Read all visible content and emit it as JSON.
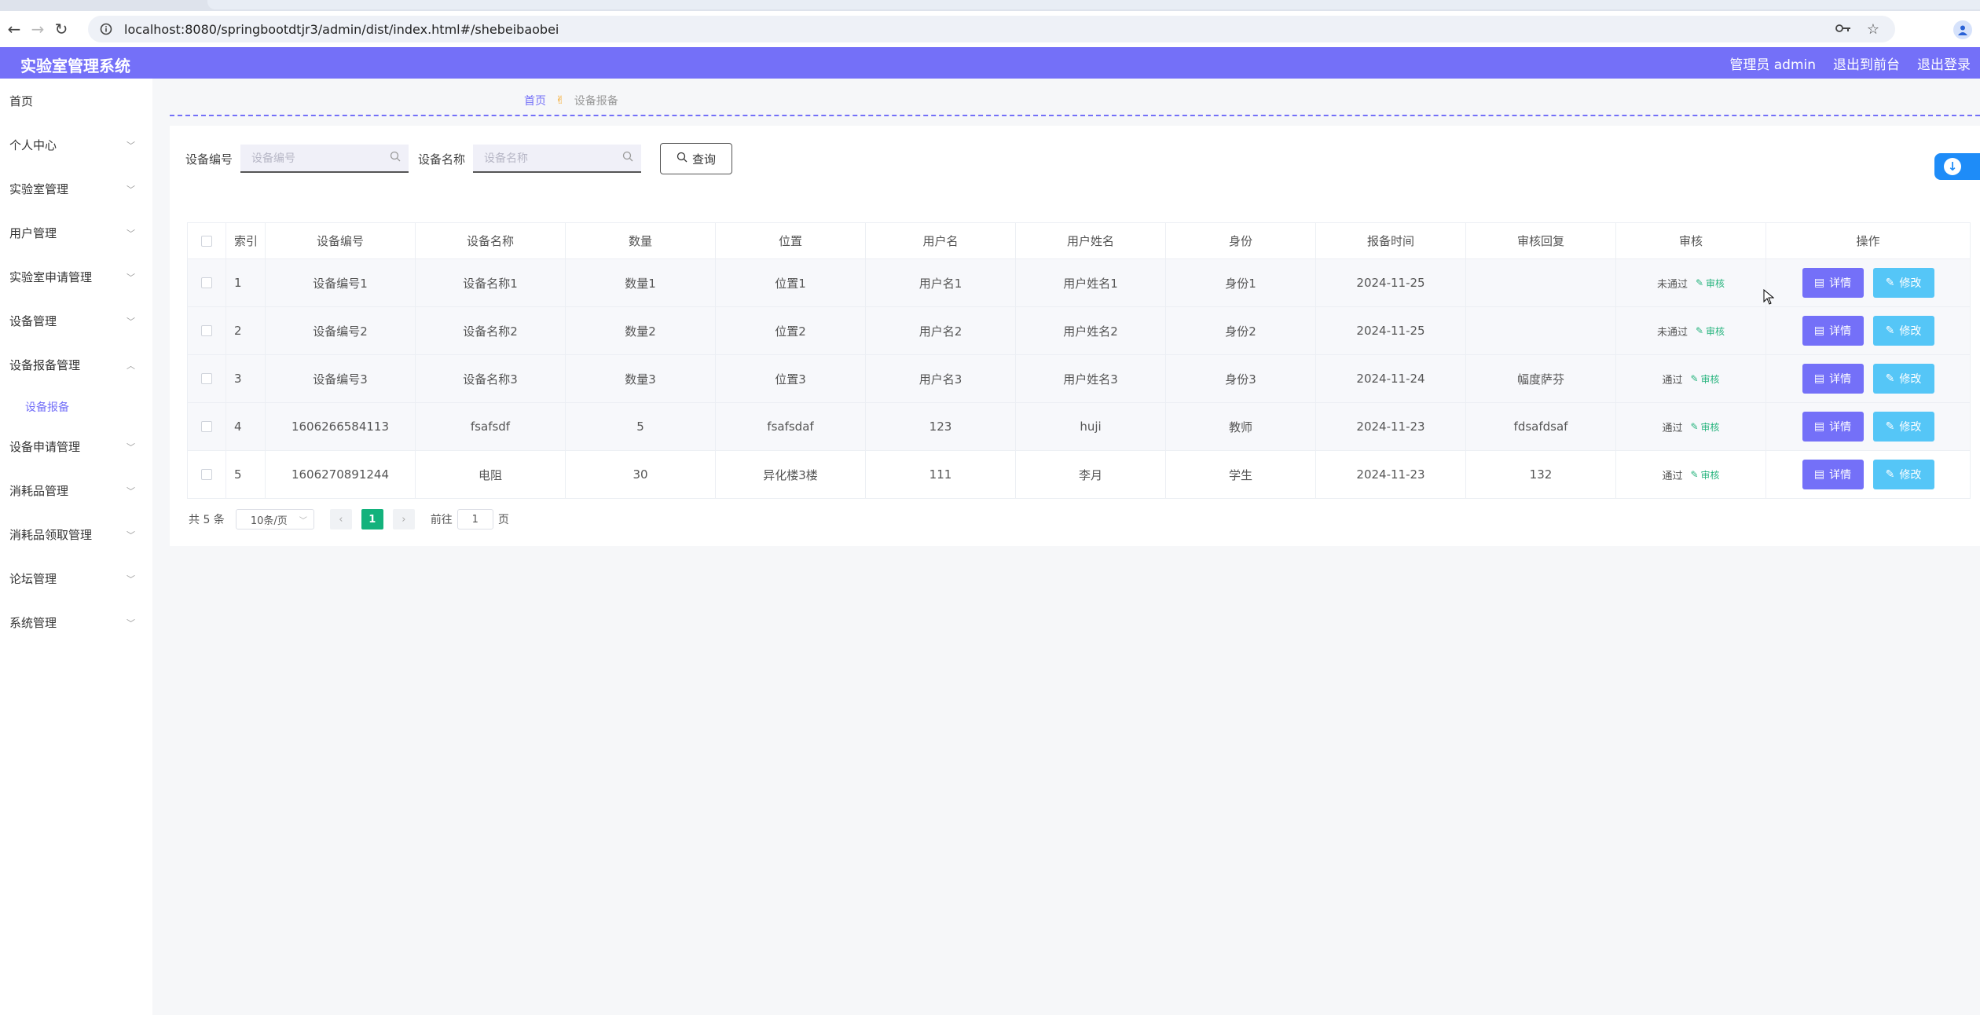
{
  "browser": {
    "url": "localhost:8080/springbootdtjr3/admin/dist/index.html#/shebeibaobei"
  },
  "header": {
    "title": "实验室管理系统",
    "user": "管理员 admin",
    "front": "退出到前台",
    "logout": "退出登录"
  },
  "sidebar": {
    "items": [
      {
        "label": "首页"
      },
      {
        "label": "个人中心"
      },
      {
        "label": "实验室管理"
      },
      {
        "label": "用户管理"
      },
      {
        "label": "实验室申请管理"
      },
      {
        "label": "设备管理"
      },
      {
        "label": "设备报备管理"
      },
      {
        "label": "设备申请管理"
      },
      {
        "label": "消耗品管理"
      },
      {
        "label": "消耗品领取管理"
      },
      {
        "label": "论坛管理"
      },
      {
        "label": "系统管理"
      }
    ],
    "subitem": "设备报备"
  },
  "breadcrumb": {
    "home": "首页",
    "current": "设备报备"
  },
  "search": {
    "code_label": "设备编号",
    "code_placeholder": "设备编号",
    "name_label": "设备名称",
    "name_placeholder": "设备名称",
    "button": "查询"
  },
  "table": {
    "headers": [
      "索引",
      "设备编号",
      "设备名称",
      "数量",
      "位置",
      "用户名",
      "用户姓名",
      "身份",
      "报备时间",
      "审核回复",
      "审核",
      "操作"
    ],
    "rows": [
      {
        "index": "1",
        "code": "设备编号1",
        "name": "设备名称1",
        "qty": "数量1",
        "loc": "位置1",
        "username": "用户名1",
        "realname": "用户姓名1",
        "role": "身份1",
        "time": "2024-11-25",
        "reply": "",
        "status": "未通过"
      },
      {
        "index": "2",
        "code": "设备编号2",
        "name": "设备名称2",
        "qty": "数量2",
        "loc": "位置2",
        "username": "用户名2",
        "realname": "用户姓名2",
        "role": "身份2",
        "time": "2024-11-25",
        "reply": "",
        "status": "未通过"
      },
      {
        "index": "3",
        "code": "设备编号3",
        "name": "设备名称3",
        "qty": "数量3",
        "loc": "位置3",
        "username": "用户名3",
        "realname": "用户姓名3",
        "role": "身份3",
        "time": "2024-11-24",
        "reply": "幅度萨芬",
        "status": "通过"
      },
      {
        "index": "4",
        "code": "1606266584113",
        "name": "fsafsdf",
        "qty": "5",
        "loc": "fsafsdaf",
        "username": "123",
        "realname": "huji",
        "role": "教师",
        "time": "2024-11-23",
        "reply": "fdsafdsaf",
        "status": "通过"
      },
      {
        "index": "5",
        "code": "1606270891244",
        "name": "电阻",
        "qty": "30",
        "loc": "异化楼3楼",
        "username": "111",
        "realname": "李月",
        "role": "学生",
        "time": "2024-11-23",
        "reply": "132",
        "status": "通过"
      }
    ],
    "audit_link": "审核",
    "detail_btn": "详情",
    "edit_btn": "修改"
  },
  "pagination": {
    "total": "共 5 条",
    "page_size": "10条/页",
    "current": "1",
    "goto_label": "前往",
    "goto_value": "1",
    "goto_suffix": "页"
  },
  "colors": {
    "primary": "#7470f8",
    "edit": "#55c6f7",
    "success": "#13b27c"
  }
}
